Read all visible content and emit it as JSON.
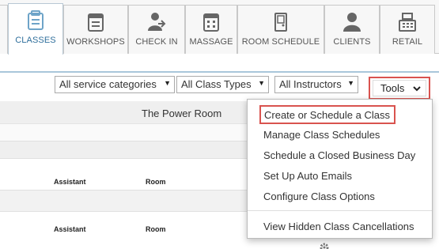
{
  "nav": {
    "tabs": [
      {
        "label": "CLASSES",
        "icon": "classes-icon",
        "active": true
      },
      {
        "label": "WORKSHOPS",
        "icon": "workshops-icon",
        "active": false
      },
      {
        "label": "CHECK IN",
        "icon": "check-in-icon",
        "active": false
      },
      {
        "label": "MASSAGE",
        "icon": "massage-icon",
        "active": false
      },
      {
        "label": "ROOM SCHEDULE",
        "icon": "room-schedule-icon",
        "active": false
      },
      {
        "label": "CLIENTS",
        "icon": "clients-icon",
        "active": false
      },
      {
        "label": "RETAIL",
        "icon": "retail-icon",
        "active": false
      }
    ]
  },
  "filters": {
    "service_categories": "All service categories",
    "class_types": "All Class Types",
    "instructors": "All Instructors",
    "tools_label": "Tools"
  },
  "schedule": {
    "room_header": "The Power Room",
    "rows": [
      {
        "assistant": "Assistant",
        "room": "Room"
      },
      {
        "assistant": "Assistant",
        "room": "Room"
      }
    ]
  },
  "tools_menu": {
    "items": [
      "Create or Schedule a Class",
      "Manage Class Schedules",
      "Schedule a Closed Business Day",
      "Set Up Auto Emails",
      "Configure Class Options",
      "View Hidden Class Cancellations"
    ]
  },
  "colors": {
    "highlight": "#d9534f",
    "active_tab_text": "#2f6f9c",
    "divider_blue": "#a9c6da"
  }
}
